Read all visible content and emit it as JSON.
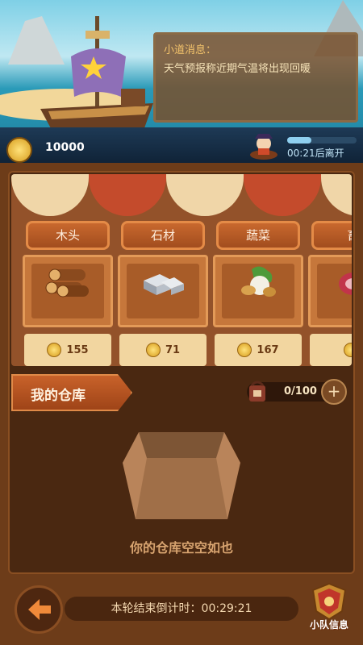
{
  "scene": {
    "sea_color": "#1d7f9d",
    "sky_color": "#7fd0e6"
  },
  "notice": {
    "title": "小道消息：",
    "text": "天气预报称近期气温将出现回暖"
  },
  "status": {
    "gold": "10000",
    "leave_text": "00:21后离开",
    "progress": 0.35
  },
  "shop": {
    "items": [
      {
        "name": "木头",
        "price": "155",
        "icon": "wood-logs-icon"
      },
      {
        "name": "石材",
        "price": "71",
        "icon": "stone-icon"
      },
      {
        "name": "蔬菜",
        "price": "167",
        "icon": "vegetables-icon"
      },
      {
        "name": "畜",
        "price": "",
        "icon": "meat-icon"
      }
    ]
  },
  "warehouse": {
    "title": "我的仓库",
    "capacity": "0/100",
    "empty_text": "你的仓库空空如也"
  },
  "footer": {
    "countdown": "本轮结束倒计时：00:29:21",
    "team_label": "小队信息"
  },
  "colors": {
    "accent": "#c8622a",
    "panel": "#4a2811",
    "frame": "#6d3c19"
  }
}
